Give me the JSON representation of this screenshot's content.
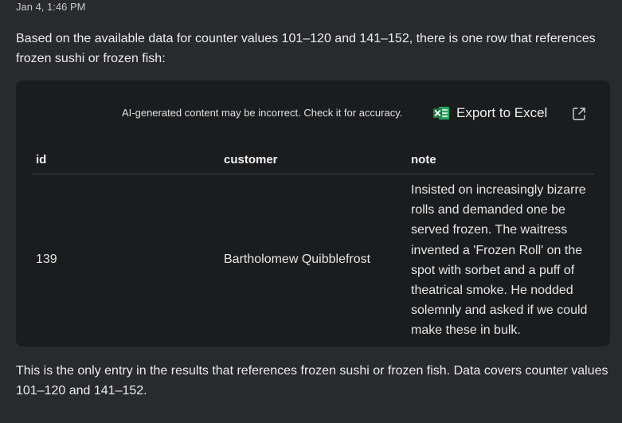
{
  "message": {
    "timestamp": "Jan 4, 1:46 PM",
    "intro": "Based on the available data for counter values 101–120 and 141–152, there is one row that references frozen sushi or frozen fish:",
    "outro": "This is the only entry in the results that references frozen sushi or frozen fish. Data covers counter values 101–120 and 141–152."
  },
  "result_card": {
    "disclaimer": "AI-generated content may be incorrect. Check it for accuracy.",
    "export_label": "Export to Excel",
    "export_icon": "excel-icon",
    "expand_icon": "expand-icon",
    "columns": [
      "id",
      "customer",
      "note"
    ],
    "rows": [
      {
        "id": "139",
        "customer": "Bartholomew Quibblefrost",
        "note": "Insisted on increasingly bizarre rolls and demanded one be served frozen. The waitress invented a 'Frozen Roll' on the spot with sorbet and a puff of theatrical smoke. He nodded solemnly and asked if we could make these in bulk."
      }
    ]
  },
  "colors": {
    "background": "#292a2d",
    "card": "#1b1c1e",
    "excel_green": "#1d7a45"
  }
}
